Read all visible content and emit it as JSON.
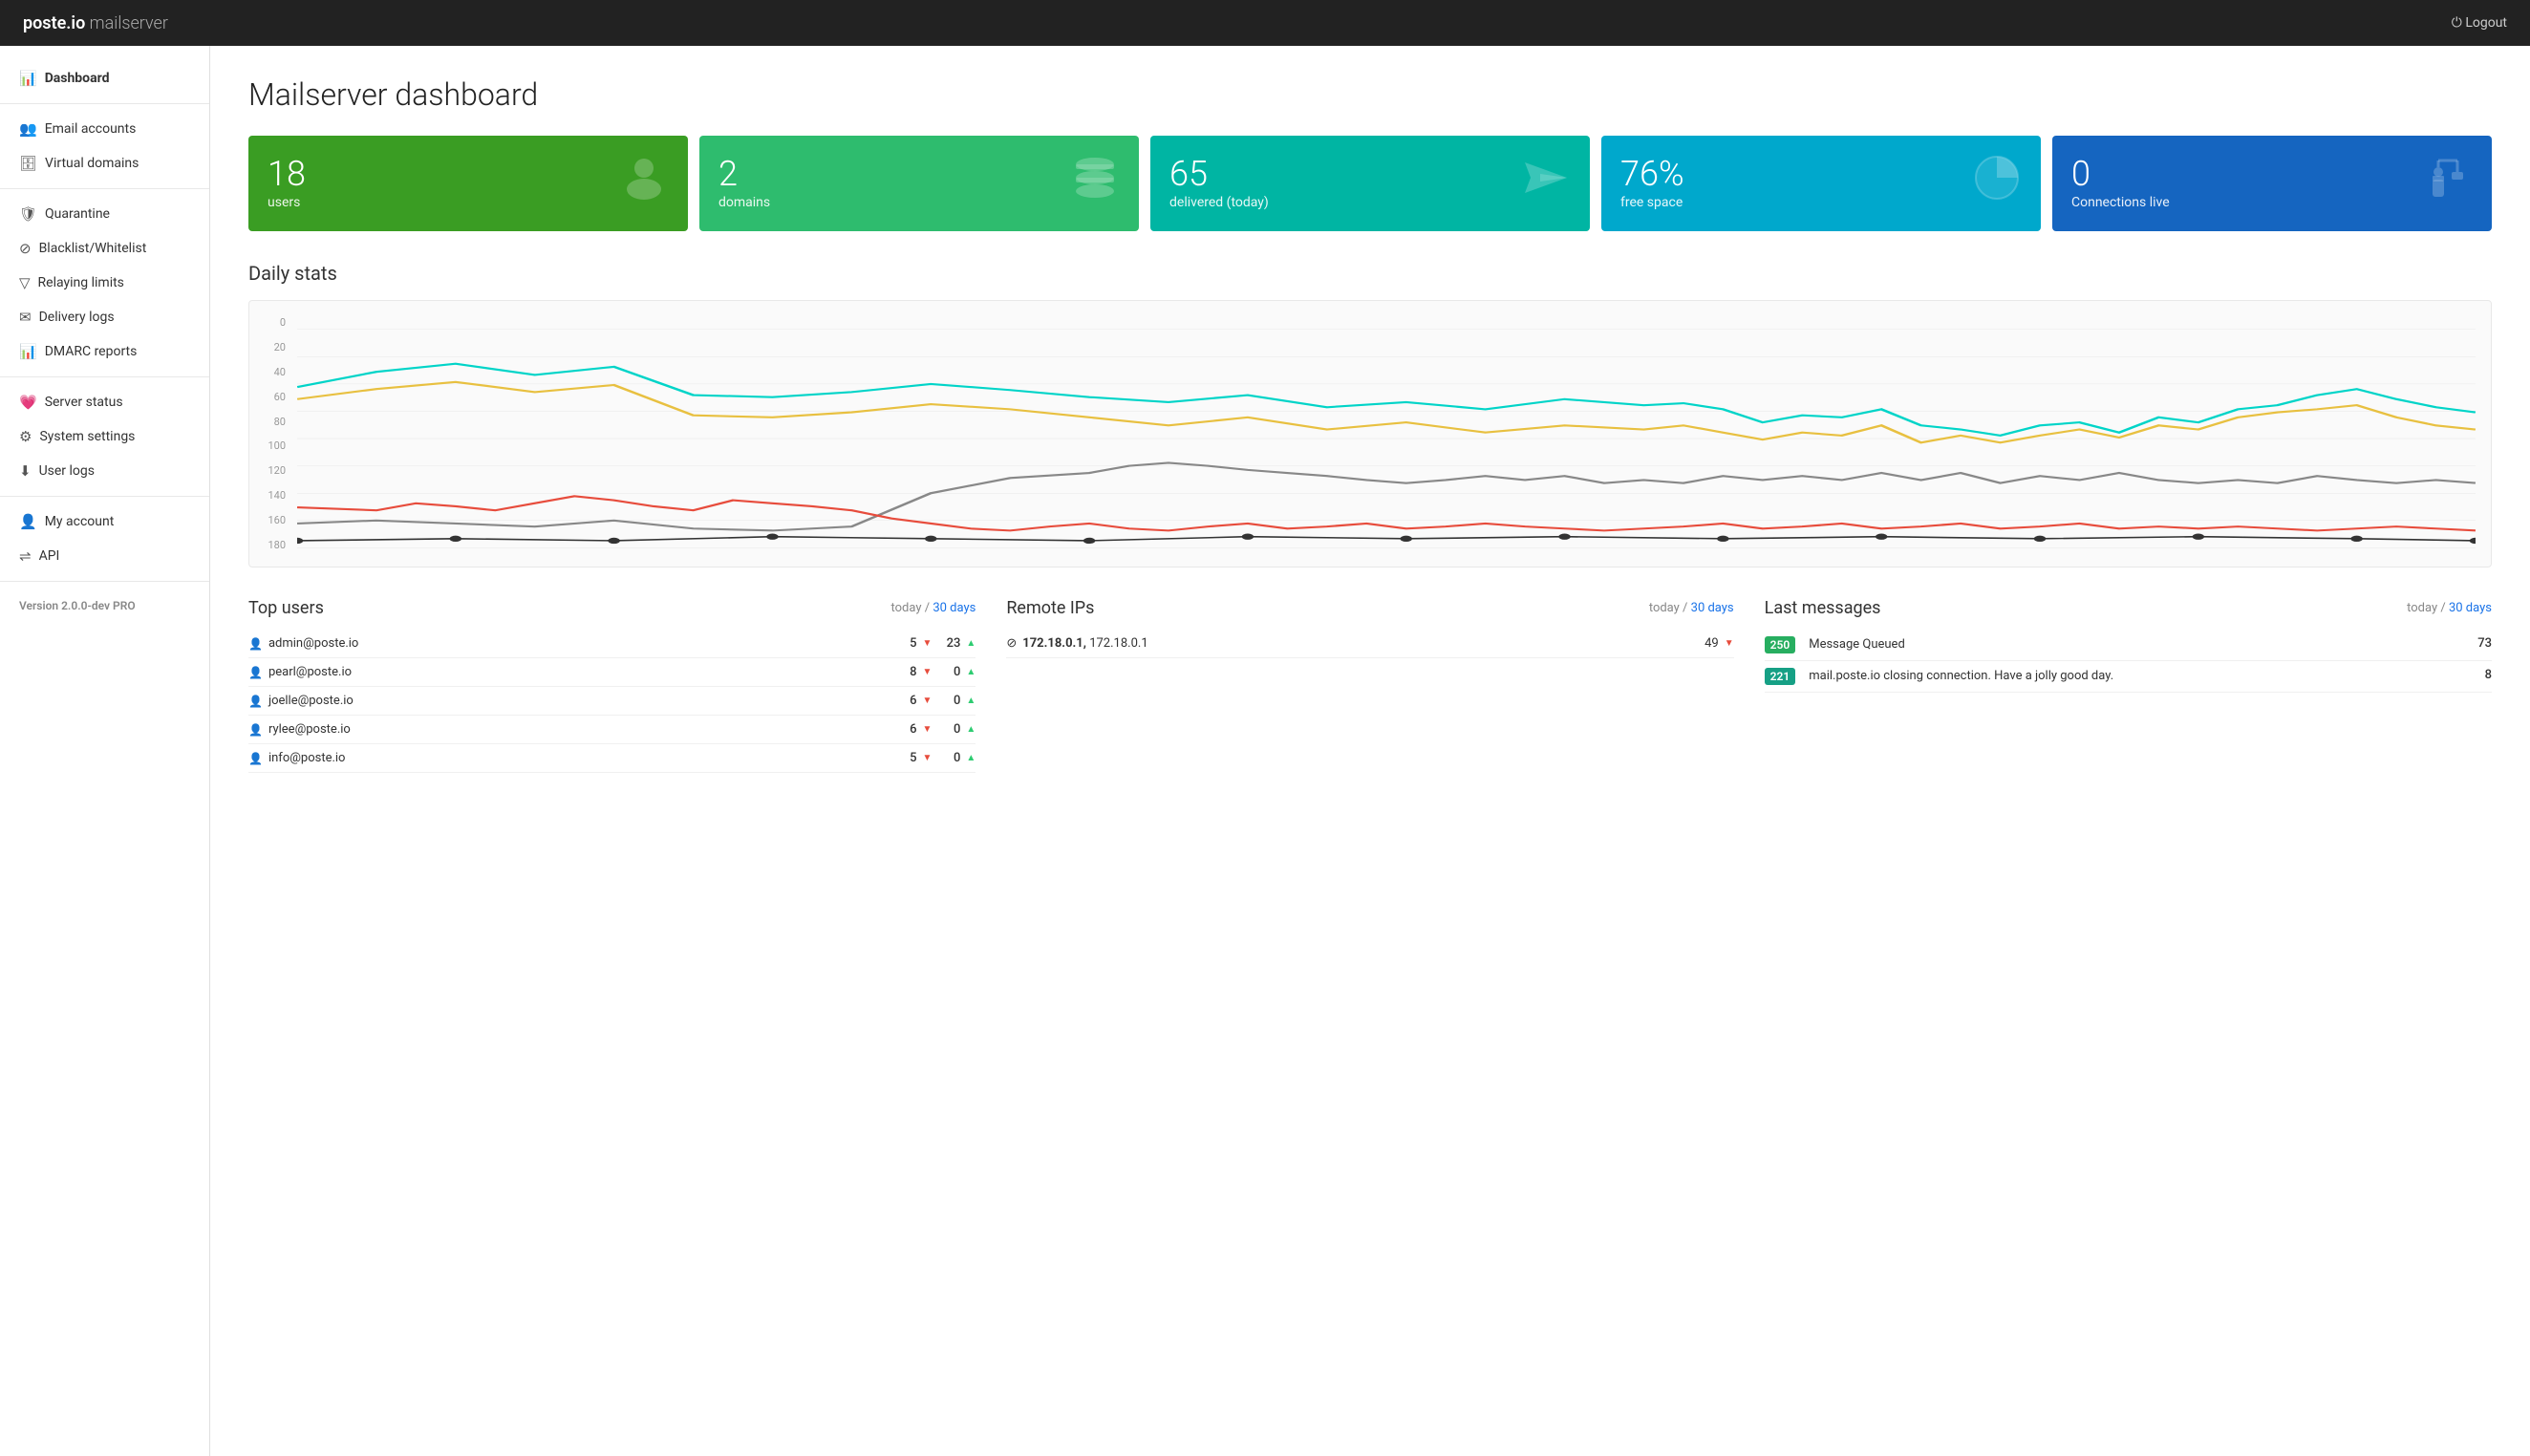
{
  "header": {
    "logo_brand": "poste.io",
    "logo_sub": " mailserver",
    "logout_label": "⏻ Logout"
  },
  "sidebar": {
    "items": [
      {
        "id": "dashboard",
        "label": "Dashboard",
        "icon": "📊",
        "active": true
      },
      {
        "id": "email-accounts",
        "label": "Email accounts",
        "icon": "👥"
      },
      {
        "id": "virtual-domains",
        "label": "Virtual domains",
        "icon": "🗄"
      },
      {
        "id": "quarantine",
        "label": "Quarantine",
        "icon": "🛡"
      },
      {
        "id": "blacklist-whitelist",
        "label": "Blacklist/Whitelist",
        "icon": "⊘"
      },
      {
        "id": "relaying-limits",
        "label": "Relaying limits",
        "icon": "▽"
      },
      {
        "id": "delivery-logs",
        "label": "Delivery logs",
        "icon": "✉"
      },
      {
        "id": "dmarc-reports",
        "label": "DMARC reports",
        "icon": "📊"
      },
      {
        "id": "server-status",
        "label": "Server status",
        "icon": "💗"
      },
      {
        "id": "system-settings",
        "label": "System settings",
        "icon": "⚙"
      },
      {
        "id": "user-logs",
        "label": "User logs",
        "icon": "⬇"
      },
      {
        "id": "my-account",
        "label": "My account",
        "icon": "👤"
      },
      {
        "id": "api",
        "label": "API",
        "icon": "⇌"
      }
    ],
    "version_label": "Version",
    "version": "2.0.0-dev PRO"
  },
  "page": {
    "title": "Mailserver dashboard"
  },
  "stat_cards": [
    {
      "value": "18",
      "label": "users",
      "icon": "👤",
      "color_class": "card-green1"
    },
    {
      "value": "2",
      "label": "domains",
      "icon": "🗄",
      "color_class": "card-green2"
    },
    {
      "value": "65",
      "label": "delivered (today)",
      "icon": "➤",
      "color_class": "card-teal"
    },
    {
      "value": "76%",
      "label": "free space",
      "icon": "◑",
      "color_class": "card-cyan"
    },
    {
      "value": "0",
      "label": "Connections live",
      "icon": "🔌",
      "color_class": "card-blue"
    }
  ],
  "daily_stats": {
    "title": "Daily stats",
    "y_labels": [
      "0",
      "20",
      "40",
      "60",
      "80",
      "100",
      "120",
      "140",
      "160",
      "180"
    ]
  },
  "top_users": {
    "title": "Top users",
    "today_label": "today /",
    "days_label": "30 days",
    "rows": [
      {
        "email": "admin@poste.io",
        "down": "5",
        "up": "23"
      },
      {
        "email": "pearl@poste.io",
        "down": "8",
        "up": "0"
      },
      {
        "email": "joelle@poste.io",
        "down": "6",
        "up": "0"
      },
      {
        "email": "rylee@poste.io",
        "down": "6",
        "up": "0"
      },
      {
        "email": "info@poste.io",
        "down": "5",
        "up": "0"
      }
    ]
  },
  "remote_ips": {
    "title": "Remote IPs",
    "today_label": "today /",
    "days_label": "30 days",
    "rows": [
      {
        "ip_bold": "172.18.0.1,",
        "ip_rest": " 172.18.0.1",
        "count": "49",
        "arrow": "down"
      }
    ]
  },
  "last_messages": {
    "title": "Last messages",
    "today_label": "today /",
    "days_label": "30 days",
    "rows": [
      {
        "badge": "250",
        "badge_color": "badge-green",
        "text": "Message Queued",
        "count": "73"
      },
      {
        "badge": "221",
        "badge_color": "badge-teal",
        "text": "mail.poste.io closing connection. Have a jolly good day.",
        "count": "8"
      }
    ]
  }
}
